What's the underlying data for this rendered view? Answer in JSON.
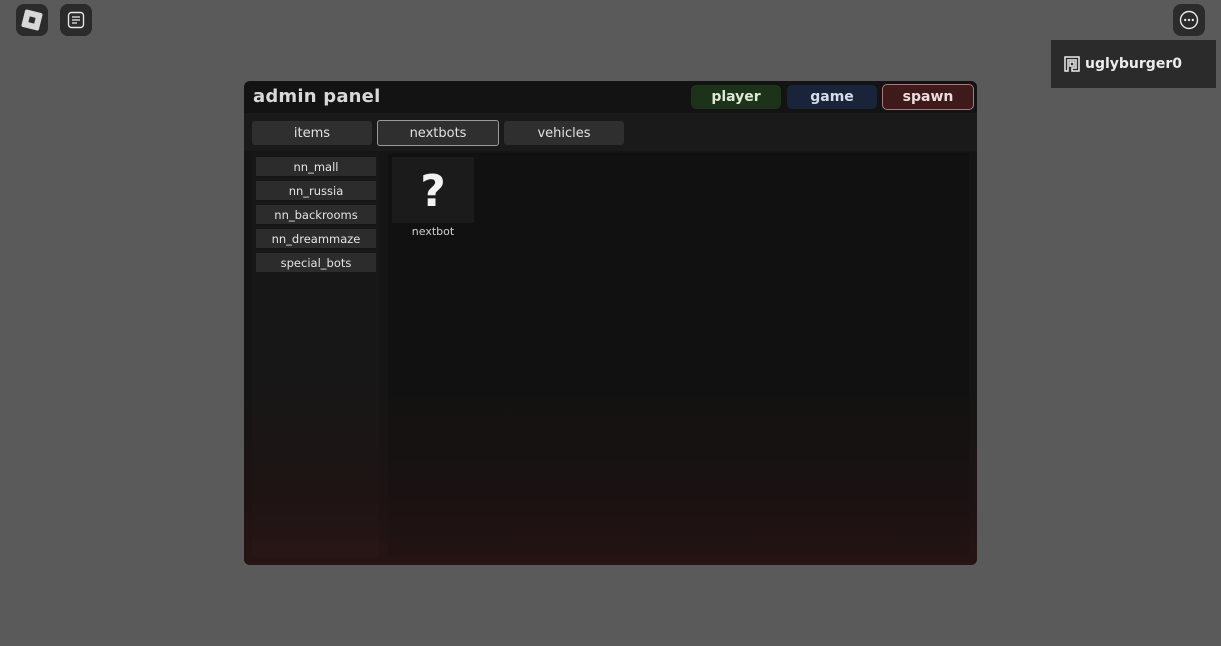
{
  "topbar": {
    "roblox_icon": "roblox-logo-icon",
    "chat_icon": "chat-icon",
    "more_icon": "more-options-icon"
  },
  "user": {
    "icon": "premium-icon",
    "username": "uglyburger0"
  },
  "panel": {
    "title": "admin panel",
    "header_buttons": {
      "player": "player",
      "game": "game",
      "spawn": "spawn"
    },
    "tabs": {
      "items": "items",
      "nextbots": "nextbots",
      "vehicles": "vehicles"
    },
    "active_tab": "nextbots",
    "categories": [
      "nn_mall",
      "nn_russia",
      "nn_backrooms",
      "nn_dreammaze",
      "special_bots"
    ],
    "bots": [
      {
        "symbol": "?",
        "label": "nextbot"
      }
    ]
  },
  "colors": {
    "background": "#5a5a5a",
    "panel": "#131313",
    "player_button": "#1c3319",
    "game_button": "#19243a",
    "spawn_button": "#3f1a1a"
  }
}
